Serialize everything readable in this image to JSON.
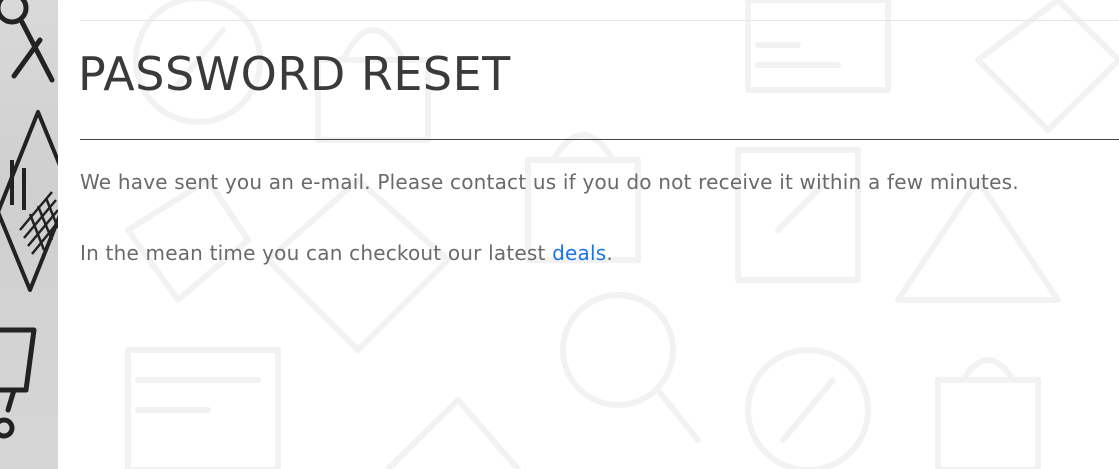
{
  "page": {
    "title": "PASSWORD RESET",
    "sent_message": "We have sent you an e-mail. Please contact us if you do not receive it within a few minutes.",
    "meantime_prefix": "In the mean time you can checkout our latest ",
    "deals_link": "deals",
    "meantime_suffix": "."
  },
  "colors": {
    "link": "#1a73e8",
    "title": "#3a3a3a",
    "body_text": "#6a6a6a",
    "rule": "#444444"
  },
  "icons": {
    "side_strip": [
      "scissors-icon",
      "card-with-keypad-icon",
      "shopping-cart-icon"
    ],
    "background": [
      "percent-badge-icon",
      "shopping-bag-icon",
      "credit-card-icon",
      "price-tag-icon",
      "magnifier-icon",
      "scissors-icon"
    ]
  }
}
